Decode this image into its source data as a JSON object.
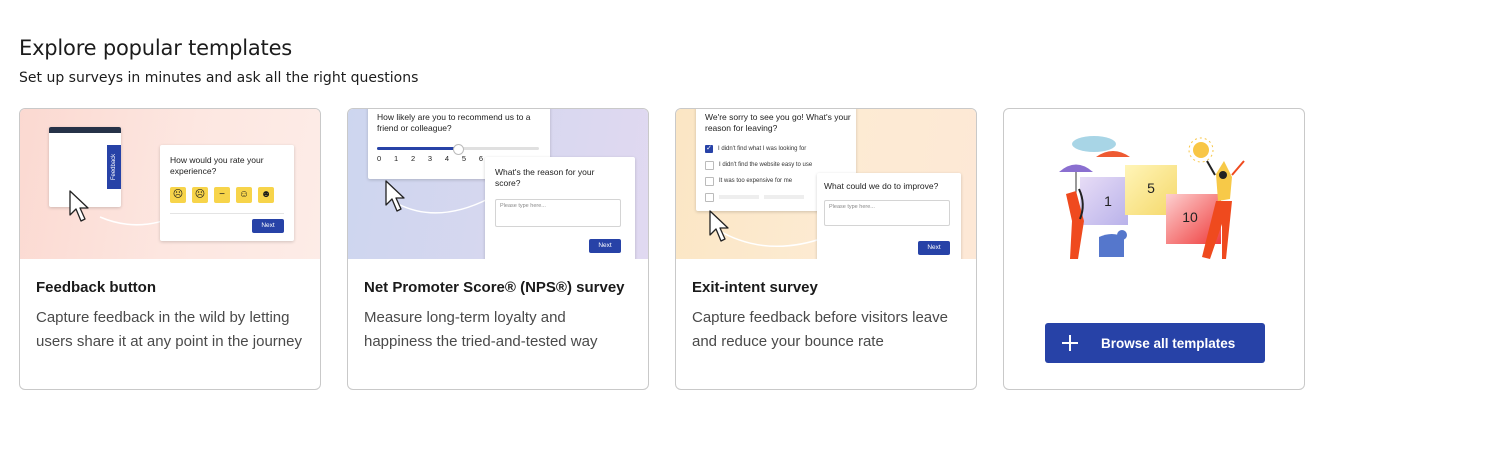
{
  "header": {
    "title": "Explore popular templates",
    "subtitle": "Set up surveys in minutes and ask all the right questions"
  },
  "cards": [
    {
      "title": "Feedback button",
      "description": "Capture feedback in the wild by letting users share it at any point in the journey",
      "preview": {
        "tab_label": "Feedback",
        "question": "How would you rate your experience?",
        "next_label": "Next"
      }
    },
    {
      "title": "Net Promoter Score® (NPS®) survey",
      "description": "Measure long-term loyalty and happiness the tried-and-tested way",
      "preview": {
        "question": "How likely are you to recommend us to a friend or colleague?",
        "scale": [
          "0",
          "1",
          "2",
          "3",
          "4",
          "5",
          "6"
        ],
        "selected_score": 5,
        "followup": "What's the reason for your score?",
        "placeholder": "Please type here...",
        "next_label": "Next"
      }
    },
    {
      "title": "Exit-intent survey",
      "description": "Capture feedback before visitors leave and reduce your bounce rate",
      "preview": {
        "question": "We're sorry to see you go! What's your reason for leaving?",
        "options": [
          {
            "label": "I didn't find what I was looking for",
            "checked": true
          },
          {
            "label": "I didn't find the website easy to use",
            "checked": false
          },
          {
            "label": "It was too expensive for me",
            "checked": false
          }
        ],
        "followup": "What could we do to improve?",
        "placeholder": "Please type here...",
        "next_label": "Next"
      }
    }
  ],
  "browse": {
    "label": "Browse all templates",
    "illustration_numbers": [
      "1",
      "5",
      "10"
    ]
  },
  "colors": {
    "accent": "#2742a7",
    "emoji_yellow": "#f7d44a",
    "card_border": "#c9c9c9"
  }
}
